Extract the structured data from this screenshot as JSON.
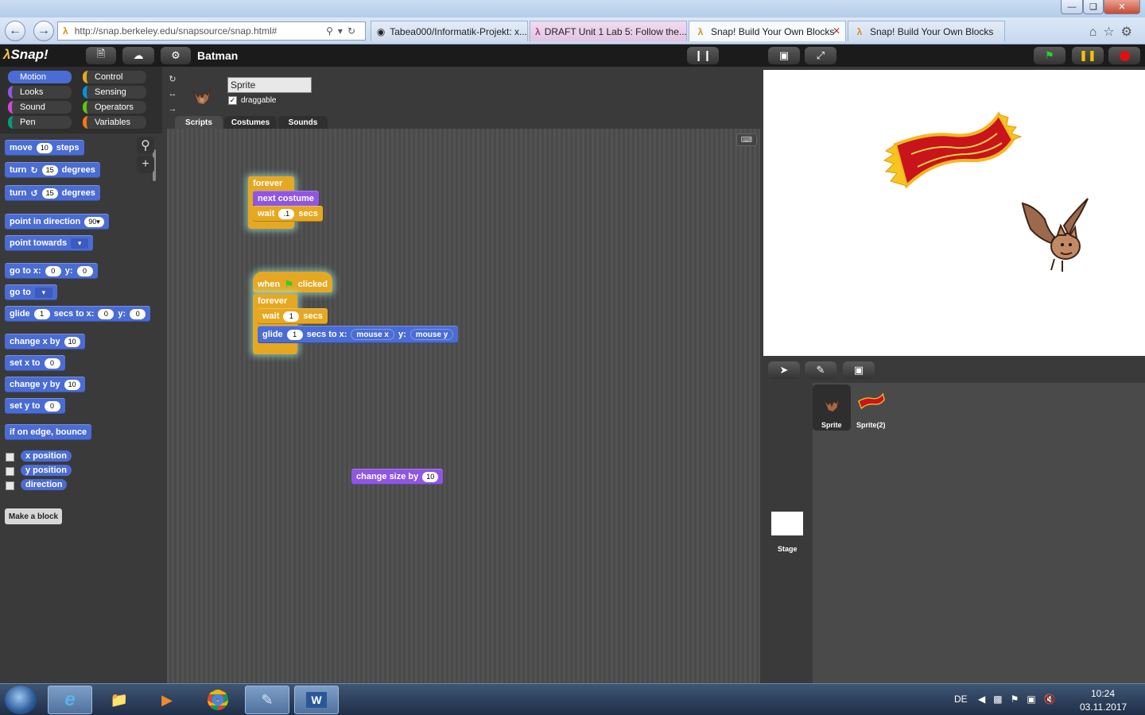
{
  "browser": {
    "url": "http://snap.berkeley.edu/snapsource/snap.html#",
    "tabs": [
      {
        "label": "Tabea000/Informatik-Projekt: x...",
        "icon": "github-icon"
      },
      {
        "label": "DRAFT Unit 1 Lab 5: Follow the...",
        "icon": "bjc-icon"
      },
      {
        "label": "Snap! Build Your Own Blocks",
        "icon": "snap-lambda-icon",
        "active": true,
        "close": "✕"
      },
      {
        "label": "Snap! Build Your Own Blocks",
        "icon": "snap-lambda-icon"
      }
    ]
  },
  "snap": {
    "logo": "Snap!",
    "project_name": "Batman",
    "categories": [
      {
        "label": "Motion",
        "color": "#4a6cd4",
        "selected": true
      },
      {
        "label": "Control",
        "color": "#e6a822"
      },
      {
        "label": "Looks",
        "color": "#8f56e3"
      },
      {
        "label": "Sensing",
        "color": "#0494dc"
      },
      {
        "label": "Sound",
        "color": "#cf4ad9"
      },
      {
        "label": "Operators",
        "color": "#62c213"
      },
      {
        "label": "Pen",
        "color": "#00a178"
      },
      {
        "label": "Variables",
        "color": "#f3761d"
      }
    ],
    "palette": {
      "move": {
        "label": "move",
        "value": "10",
        "suffix": "steps"
      },
      "turn_cw": {
        "label": "turn",
        "value": "15",
        "suffix": "degrees"
      },
      "turn_ccw": {
        "label": "turn",
        "value": "15",
        "suffix": "degrees"
      },
      "point_direction": {
        "label": "point in direction",
        "value": "90"
      },
      "point_towards": {
        "label": "point towards"
      },
      "go_to_xy": {
        "label": "go to x:",
        "x": "0",
        "y_label": "y:",
        "y": "0"
      },
      "go_to": {
        "label": "go to"
      },
      "glide": {
        "label": "glide",
        "secs": "1",
        "mid": "secs to x:",
        "x": "0",
        "y_label": "y:",
        "y": "0"
      },
      "change_x": {
        "label": "change x by",
        "value": "10"
      },
      "set_x": {
        "label": "set x to",
        "value": "0"
      },
      "change_y": {
        "label": "change y by",
        "value": "10"
      },
      "set_y": {
        "label": "set y to",
        "value": "0"
      },
      "bounce": {
        "label": "if on edge, bounce"
      },
      "x_position": "x position",
      "y_position": "y position",
      "direction": "direction",
      "make_block": "Make a block"
    },
    "sprite": {
      "name": "Sprite",
      "draggable_label": "draggable",
      "draggable": true
    },
    "editor_tabs": [
      "Scripts",
      "Costumes",
      "Sounds"
    ],
    "scripts": {
      "script1": {
        "forever": "forever",
        "next_costume": "next costume",
        "wait": "wait",
        "wait_value": ".1",
        "secs": "secs"
      },
      "script2": {
        "when": "when",
        "clicked": "clicked",
        "forever": "forever",
        "wait": "wait",
        "wait_value": "1",
        "secs": "secs",
        "glide": "glide",
        "glide_secs": "1",
        "mid": "secs to x:",
        "mouse_x": "mouse x",
        "y_label": "y:",
        "mouse_y": "mouse y"
      },
      "loose": {
        "label": "change size by",
        "value": "10"
      }
    },
    "corral": {
      "sprites": [
        {
          "name": "Sprite"
        },
        {
          "name": "Sprite(2)"
        }
      ],
      "stage_label": "Stage"
    }
  },
  "taskbar": {
    "language": "DE",
    "time": "10:24",
    "date": "03.11.2017",
    "apps": [
      "internet-explorer-icon",
      "file-explorer-icon",
      "media-player-icon",
      "chrome-icon",
      "notepad-icon",
      "word-icon"
    ]
  }
}
